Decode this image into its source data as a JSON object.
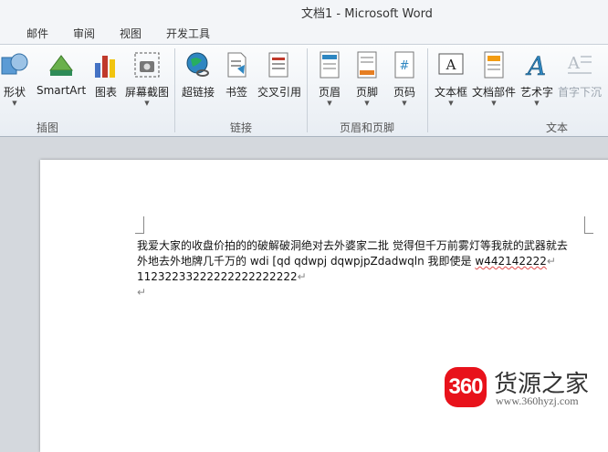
{
  "window": {
    "title": "文档1  -  Microsoft Word"
  },
  "tabs": [
    "邮件",
    "审阅",
    "视图",
    "开发工具"
  ],
  "ribbon": {
    "groups": {
      "illustrations": {
        "label": "插图",
        "buttons": [
          "形状",
          "SmartArt",
          "图表",
          "屏幕截图"
        ]
      },
      "links": {
        "label": "链接",
        "buttons": [
          "超链接",
          "书签",
          "交叉引用"
        ]
      },
      "header_footer": {
        "label": "页眉和页脚",
        "buttons": [
          "页眉",
          "页脚",
          "页码"
        ]
      },
      "text": {
        "label": "文本",
        "buttons": [
          "文本框",
          "文档部件",
          "艺术字",
          "首字下沉"
        ]
      }
    }
  },
  "document": {
    "line1": "我爱大家的收盘价拍的的破解破洞绝对去外婆家二批  觉得但千万前雾灯等我就的武器就去",
    "line2_a": "外地去外地牌几千万的 wdi [qd qdwpj dqwpjpZdadwqln 我即使是 ",
    "line2_b": "w442142222",
    "line3": "11232233222222222222222",
    "paragraph_mark": "↵"
  },
  "watermark": {
    "logo_text": "360",
    "name": "货源之家",
    "url": "www.360hyzj.com"
  },
  "colors": {
    "ribbon_bg": "#f3f5f8",
    "doc_bg": "#d4d8dd",
    "brand_red": "#e8121b"
  }
}
